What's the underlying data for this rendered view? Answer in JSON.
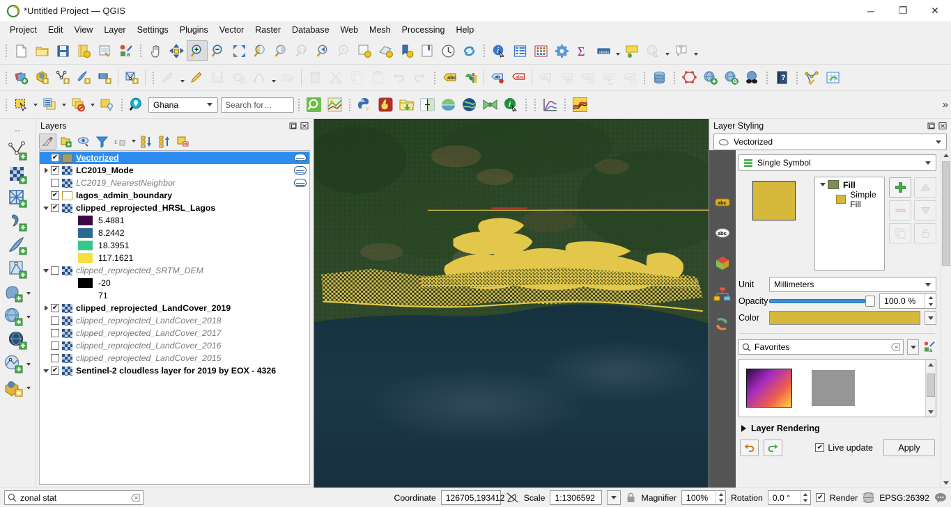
{
  "window": {
    "title": "*Untitled Project — QGIS",
    "app_icon": "qgis-logo-icon",
    "minimize": "─",
    "maximize": "❐",
    "close": "✕"
  },
  "menubar": {
    "items": [
      {
        "label": "Project"
      },
      {
        "label": "Edit"
      },
      {
        "label": "View"
      },
      {
        "label": "Layer"
      },
      {
        "label": "Settings"
      },
      {
        "label": "Plugins"
      },
      {
        "label": "Vector"
      },
      {
        "label": "Raster"
      },
      {
        "label": "Database"
      },
      {
        "label": "Web"
      },
      {
        "label": "Mesh"
      },
      {
        "label": "Processing"
      },
      {
        "label": "Help"
      }
    ]
  },
  "toolbar_row1": {
    "icons": [
      "new-project-icon",
      "open-project-icon",
      "save-project-icon",
      "save-project-as-icon",
      "new-print-layout-icon",
      "style-manager-icon",
      "pan-map-icon",
      "pan-to-selection-icon",
      "zoom-in-icon",
      "zoom-out-icon",
      "zoom-full-icon",
      "zoom-to-selection-icon",
      "zoom-to-layer-icon",
      "zoom-native-icon",
      "zoom-last-icon",
      "zoom-next-icon",
      "refresh-layer-icon",
      "show-map-tips-icon",
      "new-bookmark-icon",
      "show-bookmarks-icon",
      "temporal-controller-icon",
      "refresh-icon",
      "identify-features-icon",
      "open-attribute-table-icon",
      "field-calculator-icon",
      "options-icon",
      "statistical-summary-icon",
      "measure-line-icon",
      "map-tips-icon",
      "run-feature-action-icon",
      "text-annotation-icon"
    ]
  },
  "toolbar_row2": {
    "icons": [
      "add-vector-layer-icon",
      "add-raster-layer-icon",
      "add-delimited-text-icon",
      "add-spatialite-icon",
      "add-mesh-layer-icon",
      "new-shapefile-layer-icon",
      "current-edits-icon",
      "toggle-editing-icon",
      "save-layer-edits-icon",
      "add-polygon-feature-icon",
      "vertex-tool-icon",
      "modify-attributes-icon",
      "delete-selected-icon",
      "cut-features-icon",
      "copy-features-icon",
      "paste-features-icon",
      "undo-icon",
      "redo-icon",
      "label-layer-icon",
      "diagram-layer-icon",
      "pin-labels-icon",
      "highlight-labels-icon",
      "move-label-icon",
      "show-hide-labels-icon",
      "change-label-icon",
      "rotate-label-icon",
      "change-label-properties-icon",
      "db-manager-icon",
      "topology-checker-icon",
      "add-wms-layer-icon",
      "metasearch-icon",
      "qgis-browser-icon",
      "help-icon",
      "processing-toolbox-icon",
      "refresh-attribute-table-icon"
    ]
  },
  "toolbar_row3": {
    "icons": [
      "select-features-icon",
      "open-table-icon",
      "deselect-features-icon",
      "select-by-location-icon",
      "zoom-full-green-icon",
      "map-themes-icon",
      "python-console-icon",
      "heatmap-icon",
      "open-data-source-icon",
      "swipe-tool-icon",
      "qgis-leaf-icon",
      "quickmapservices-icon",
      "bowtie-icon",
      "plugin-info-icon",
      "plot-icon",
      "profile-tool-icon"
    ],
    "location_search": {
      "selected": "Ghana",
      "icon": "geocoder-pin-icon",
      "options": [
        "Ghana"
      ]
    },
    "search_field": {
      "placeholder": "Search for…",
      "value": ""
    },
    "overflow": "»"
  },
  "left_toolbar": {
    "icons": [
      "add-vector-layer-icon",
      "add-raster-layer-icon",
      "add-mesh-layer-icon",
      "add-delimited-text-layer-icon",
      "add-spatialite-layer-icon",
      "add-vector-tile-layer-icon",
      "add-postgis-layer-icon",
      "add-wms-layer-icon",
      "add-wfs-layer-icon",
      "add-wcs-layer-icon",
      "add-arcgis-layer-icon",
      "add-3d-layer-icon"
    ]
  },
  "layers_panel": {
    "title": "Layers",
    "dock_icon": "undock-icon",
    "close_icon": "close-icon",
    "toolbar_icons": [
      "open-layer-styling-panel-icon",
      "add-group-icon",
      "manage-layer-visibility-icon",
      "filter-legend-icon",
      "filter-legend-by-expression-icon",
      "expand-all-icon",
      "collapse-all-icon",
      "remove-layer-icon"
    ],
    "items": [
      {
        "name": "Vectorized",
        "checked": true,
        "expander": "none",
        "bold": true,
        "italic": false,
        "underline": true,
        "selected": true,
        "symbol": "fill-swatch",
        "color": "#9aa06a",
        "has_edit_badge": true,
        "children": []
      },
      {
        "name": "LC2019_Mode",
        "checked": true,
        "expander": "right",
        "bold": true,
        "italic": false,
        "underline": false,
        "selected": false,
        "symbol": "raster",
        "has_edit_badge": true,
        "children": []
      },
      {
        "name": "LC2019_NearestNeighbor",
        "checked": false,
        "expander": "none",
        "bold": false,
        "italic": true,
        "underline": false,
        "selected": false,
        "symbol": "raster",
        "has_edit_badge": true,
        "children": []
      },
      {
        "name": "lagos_admin_boundary",
        "checked": true,
        "expander": "none",
        "bold": true,
        "italic": false,
        "underline": false,
        "selected": false,
        "symbol": "outline-swatch",
        "color": "#ffffff",
        "has_edit_badge": false,
        "children": []
      },
      {
        "name": "clipped_reprojected_HRSL_Lagos",
        "checked": true,
        "expander": "down",
        "bold": true,
        "italic": false,
        "underline": false,
        "selected": false,
        "symbol": "raster",
        "has_edit_badge": false,
        "children": [
          {
            "label": "5.4881",
            "color": "#3b0a45"
          },
          {
            "label": "8.2442",
            "color": "#2e6a8e"
          },
          {
            "label": "18.3951",
            "color": "#35c88a"
          },
          {
            "label": "117.1621",
            "color": "#f7e03d"
          }
        ]
      },
      {
        "name": "clipped_reprojected_SRTM_DEM",
        "checked": false,
        "expander": "down",
        "bold": false,
        "italic": true,
        "underline": false,
        "selected": false,
        "symbol": "raster",
        "has_edit_badge": false,
        "children": [
          {
            "label": "-20",
            "color": "#000000"
          },
          {
            "label": "71",
            "color": "transparent"
          }
        ]
      },
      {
        "name": "clipped_reprojected_LandCover_2019",
        "checked": true,
        "expander": "right",
        "bold": true,
        "italic": false,
        "underline": false,
        "selected": false,
        "symbol": "raster",
        "has_edit_badge": false,
        "children": []
      },
      {
        "name": "clipped_reprojected_LandCover_2018",
        "checked": false,
        "expander": "none",
        "bold": false,
        "italic": true,
        "underline": false,
        "selected": false,
        "symbol": "raster",
        "has_edit_badge": false,
        "children": []
      },
      {
        "name": "clipped_reprojected_LandCover_2017",
        "checked": false,
        "expander": "none",
        "bold": false,
        "italic": true,
        "underline": false,
        "selected": false,
        "symbol": "raster",
        "has_edit_badge": false,
        "children": []
      },
      {
        "name": "clipped_reprojected_LandCover_2016",
        "checked": false,
        "expander": "none",
        "bold": false,
        "italic": true,
        "underline": false,
        "selected": false,
        "symbol": "raster",
        "has_edit_badge": false,
        "children": []
      },
      {
        "name": "clipped_reprojected_LandCover_2015",
        "checked": false,
        "expander": "none",
        "bold": false,
        "italic": true,
        "underline": false,
        "selected": false,
        "symbol": "raster",
        "has_edit_badge": false,
        "children": []
      },
      {
        "name": "Sentinel-2 cloudless layer for 2019 by EOX - 4326",
        "checked": true,
        "expander": "down",
        "bold": true,
        "italic": false,
        "underline": false,
        "selected": false,
        "symbol": "raster",
        "has_edit_badge": false,
        "children": []
      }
    ]
  },
  "map": {
    "basemap_description": "Sentinel-2 satellite imagery of the Lagos, Nigeria coastline with a yellow HRSL population/built-up overlay along the coastal strip and lagoon",
    "ocean_color": "#1b3040",
    "land_color": "#2e4428",
    "overlay_color": "#e3c74a"
  },
  "style_panel": {
    "title": "Layer Styling",
    "dock_icon": "undock-icon",
    "close_icon": "close-icon",
    "layer_combo": {
      "value": "Vectorized",
      "icon": "polygon-layer-icon"
    },
    "renderer_combo": {
      "value": "Single Symbol",
      "icon": "single-symbol-icon"
    },
    "rail_icons": [
      "symbology-icon",
      "labels-icon",
      "masks-icon",
      "3d-view-icon",
      "diagrams-icon",
      "actions-icon"
    ],
    "symbol_preview_color": "#d6b93b",
    "symbol_tree": [
      {
        "label": "Fill",
        "indent": 0,
        "color": "#7f8d5c",
        "bold": true,
        "expander": "down"
      },
      {
        "label": "Simple Fill",
        "indent": 1,
        "color": "#d6b93b",
        "bold": false,
        "expander": "none"
      }
    ],
    "symbol_buttons": [
      {
        "name": "add-symbol-layer-button",
        "icon": "plus-icon",
        "enabled": true
      },
      {
        "name": "move-symbol-up-button",
        "icon": "arrow-up-icon",
        "enabled": false
      },
      {
        "name": "remove-symbol-layer-button",
        "icon": "minus-icon",
        "enabled": false
      },
      {
        "name": "move-symbol-down-button",
        "icon": "arrow-down-icon",
        "enabled": false
      },
      {
        "name": "duplicate-symbol-layer-button",
        "icon": "duplicate-icon",
        "enabled": false
      },
      {
        "name": "lock-symbol-color-button",
        "icon": "lock-icon",
        "enabled": false
      }
    ],
    "unit": {
      "label": "Unit",
      "value": "Millimeters"
    },
    "opacity": {
      "label": "Opacity",
      "value": "100.0 %",
      "percent": 100
    },
    "color": {
      "label": "Color",
      "value": "#d6b93b"
    },
    "symbol_search": {
      "value": "Favorites",
      "icon": "search-icon",
      "clear_icon": "clear-icon"
    },
    "style_swatches": [
      {
        "name": "gradient-swatch",
        "kind": "gradient"
      },
      {
        "name": "gray-swatch",
        "kind": "solid",
        "color": "#969696"
      }
    ],
    "layer_rendering": {
      "label": "Layer Rendering",
      "expanded": false
    },
    "undo_icon": "undo-icon",
    "redo_icon": "redo-icon",
    "live_update": {
      "label": "Live update",
      "checked": true
    },
    "apply_button": "Apply"
  },
  "statusbar": {
    "locator": {
      "value": "zonal stat",
      "icon": "search-icon",
      "clear_icon": "clear-icon"
    },
    "coordinate": {
      "label": "Coordinate",
      "value": "126705,193412",
      "toggle_icon": "toggle-extents-icon"
    },
    "scale": {
      "label": "Scale",
      "value": "1:1306592"
    },
    "lock_icon": "lock-scale-icon",
    "magnifier": {
      "label": "Magnifier",
      "value": "100%"
    },
    "rotation": {
      "label": "Rotation",
      "value": "0.0 °"
    },
    "render": {
      "label": "Render",
      "checked": true
    },
    "crs": {
      "label": "EPSG:26392",
      "icon": "crs-globe-icon"
    },
    "messages_icon": "messages-icon"
  }
}
